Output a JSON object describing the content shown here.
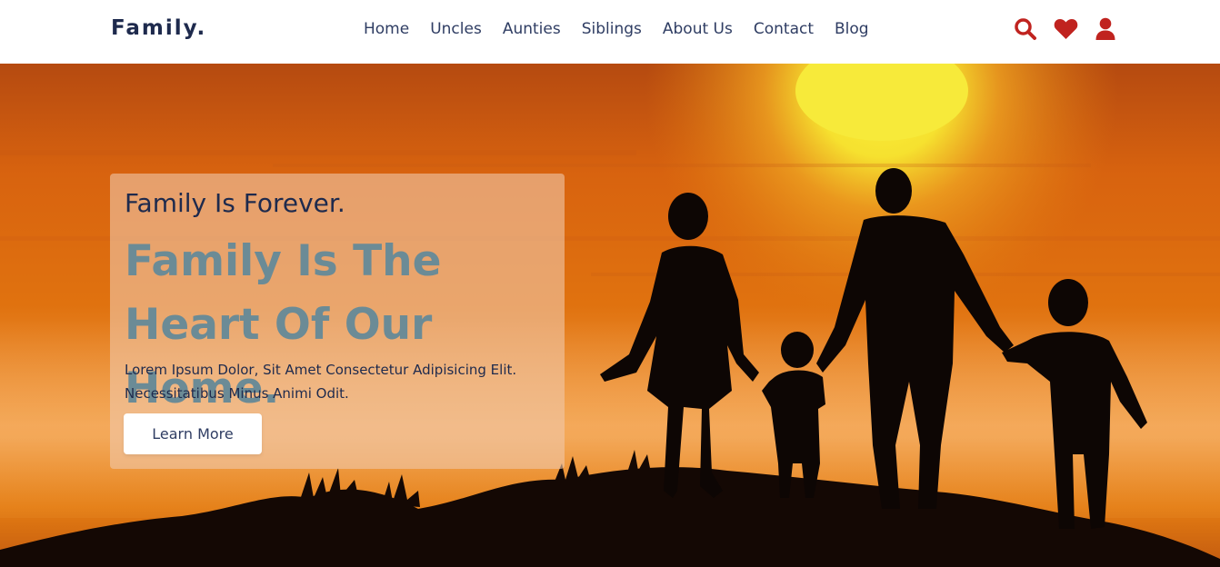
{
  "brand": {
    "logo": "Family."
  },
  "nav": {
    "items": [
      {
        "label": "Home"
      },
      {
        "label": "Uncles"
      },
      {
        "label": "Aunties"
      },
      {
        "label": "Siblings"
      },
      {
        "label": "About Us"
      },
      {
        "label": "Contact"
      },
      {
        "label": "Blog"
      }
    ]
  },
  "header_icons": [
    "search-icon",
    "heart-icon",
    "user-icon"
  ],
  "hero": {
    "eyebrow": "Family Is Forever.",
    "headline": "Family Is The Heart Of Our Home.",
    "description": "Lorem Ipsum Dolor, Sit Amet Consectetur Adipisicing Elit. Necessitatibus Minus Animi Odit.",
    "cta_label": "Learn More",
    "image_alt_icon": "family-silhouette-sunset"
  },
  "colors": {
    "brand_navy": "#1e2a4d",
    "icon_red": "#c0231f",
    "headline_teal": "#6b8b96"
  }
}
